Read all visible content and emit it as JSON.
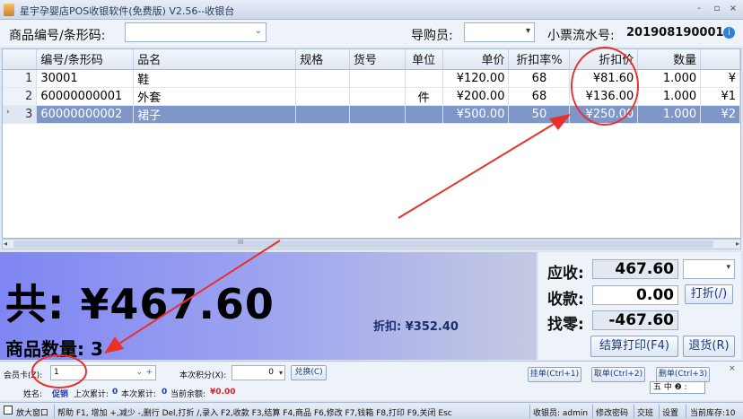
{
  "window": {
    "title": "星宇孕婴店POS收银软件(免费版) V2.56--收银台",
    "controls": [
      "-",
      "▫",
      "×"
    ]
  },
  "search": {
    "product_label": "商品编号/条形码:",
    "guide_label": "导购员:",
    "receipt_label": "小票流水号:",
    "receipt_no": "201908190001"
  },
  "table": {
    "columns": [
      "编号/条形码",
      "品名",
      "规格",
      "货号",
      "单位",
      "单价",
      "折扣率%",
      "折扣价",
      "数量",
      ""
    ],
    "rows": [
      {
        "no": "1",
        "code": "30001",
        "name": "鞋",
        "spec": "",
        "item_no": "",
        "unit": "",
        "price": "¥120.00",
        "rate": "68",
        "disc_price": "¥81.60",
        "qty": "1.000",
        "extra": "¥"
      },
      {
        "no": "2",
        "code": "60000000001",
        "name": "外套",
        "spec": "",
        "item_no": "",
        "unit": "件",
        "price": "¥200.00",
        "rate": "68",
        "disc_price": "¥136.00",
        "qty": "1.000",
        "extra": "¥1"
      },
      {
        "no": "3",
        "code": "60000000002",
        "name": "裙子",
        "spec": "",
        "item_no": "",
        "unit": "",
        "price": "¥500.00",
        "rate": "50",
        "disc_price": "¥250.00",
        "qty": "1.000",
        "extra": "¥2"
      }
    ],
    "scroll_label": "III"
  },
  "summary": {
    "total": "共: ¥467.60",
    "discount": "折扣: ¥352.40",
    "qty": "商品数量: 3"
  },
  "pay": {
    "due_label": "应收:",
    "due": "467.60",
    "received_label": "收款:",
    "received": "0.00",
    "change_label": "找零:",
    "change": "-467.60",
    "discount_btn": "打折(/)",
    "checkout_btn": "结算打印(F4)",
    "return_btn": "退货(R)"
  },
  "member": {
    "card_label": "会员卡(Z):",
    "card_value": "1",
    "points_label": "本次积分(X):",
    "points_value": "0",
    "exchange_btn": "兑换(C)",
    "hang_btn": "挂单(Ctrl+1)",
    "get_btn": "取单(Ctrl+2)",
    "delete_btn": "删单(Ctrl+3)",
    "name_label": "姓名:",
    "name_value": "促销",
    "last_total_label": "上次累计:",
    "last_total": "0",
    "this_total_label": "本次累计:",
    "this_total": "0",
    "balance_label": "当前余额:",
    "balance": "¥0.00",
    "ime_text": "五 中 ❷ :"
  },
  "status": {
    "enlarge": "放大窗口",
    "help": "帮助 F1, 增加 +,减少 -,删行 Del,打折 /,录入 F2,收款 F3,结算 F4,商品 F6,修改 F7,钱箱 F8,打印 F9,关闭 Esc",
    "cashier": "收银员: admin",
    "change_pwd": "修改密码",
    "handover": "交班",
    "settings": "设置",
    "stock": "当前库存:10"
  },
  "colors": {
    "selected_row": "#7f96c9",
    "annotation": "#e8312a",
    "total_gradient_start": "#7f86f3"
  }
}
